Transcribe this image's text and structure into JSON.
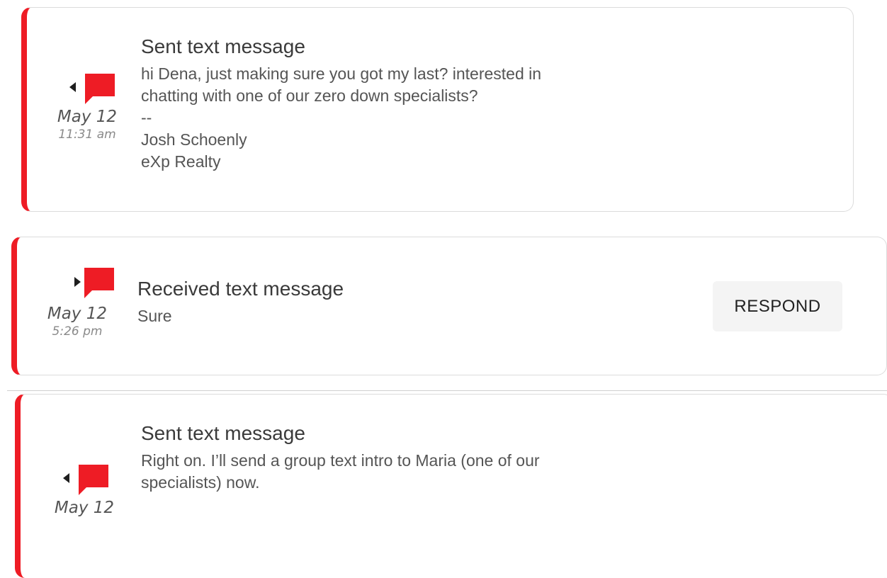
{
  "messages": [
    {
      "direction": "sent",
      "title": "Sent text message",
      "date": "May 12",
      "time": "11:31 am",
      "body": [
        "hi Dena, just making sure you got my last? interested in",
        "chatting with one of our zero down specialists?",
        "--",
        "Josh Schoenly",
        "eXp Realty"
      ]
    },
    {
      "direction": "received",
      "title": "Received text message",
      "date": "May 12",
      "time": "5:26 pm",
      "body": [
        "Sure"
      ],
      "action_label": "RESPOND"
    },
    {
      "direction": "sent",
      "title": "Sent text message",
      "date": "May 12",
      "body": [
        "Right on. I’ll send a group text intro to Maria (one of our",
        "specialists) now."
      ]
    }
  ],
  "colors": {
    "accent": "#ee1c25",
    "caret": "#1e1e1e",
    "border": "#dcdcdc",
    "button_bg": "#f4f4f4"
  },
  "icons": {
    "sent": "caret-left-icon",
    "received": "caret-right-icon",
    "message": "chat-bubble-icon"
  }
}
